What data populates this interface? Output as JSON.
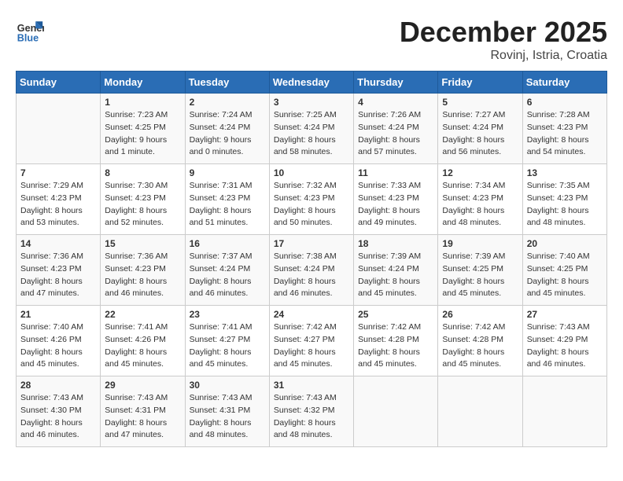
{
  "header": {
    "logo_general": "General",
    "logo_blue": "Blue",
    "month_title": "December 2025",
    "location": "Rovinj, Istria, Croatia"
  },
  "days_of_week": [
    "Sunday",
    "Monday",
    "Tuesday",
    "Wednesday",
    "Thursday",
    "Friday",
    "Saturday"
  ],
  "weeks": [
    [
      {
        "day": "",
        "sunrise": "",
        "sunset": "",
        "daylight": ""
      },
      {
        "day": "1",
        "sunrise": "Sunrise: 7:23 AM",
        "sunset": "Sunset: 4:25 PM",
        "daylight": "Daylight: 9 hours and 1 minute."
      },
      {
        "day": "2",
        "sunrise": "Sunrise: 7:24 AM",
        "sunset": "Sunset: 4:24 PM",
        "daylight": "Daylight: 9 hours and 0 minutes."
      },
      {
        "day": "3",
        "sunrise": "Sunrise: 7:25 AM",
        "sunset": "Sunset: 4:24 PM",
        "daylight": "Daylight: 8 hours and 58 minutes."
      },
      {
        "day": "4",
        "sunrise": "Sunrise: 7:26 AM",
        "sunset": "Sunset: 4:24 PM",
        "daylight": "Daylight: 8 hours and 57 minutes."
      },
      {
        "day": "5",
        "sunrise": "Sunrise: 7:27 AM",
        "sunset": "Sunset: 4:24 PM",
        "daylight": "Daylight: 8 hours and 56 minutes."
      },
      {
        "day": "6",
        "sunrise": "Sunrise: 7:28 AM",
        "sunset": "Sunset: 4:23 PM",
        "daylight": "Daylight: 8 hours and 54 minutes."
      }
    ],
    [
      {
        "day": "7",
        "sunrise": "Sunrise: 7:29 AM",
        "sunset": "Sunset: 4:23 PM",
        "daylight": "Daylight: 8 hours and 53 minutes."
      },
      {
        "day": "8",
        "sunrise": "Sunrise: 7:30 AM",
        "sunset": "Sunset: 4:23 PM",
        "daylight": "Daylight: 8 hours and 52 minutes."
      },
      {
        "day": "9",
        "sunrise": "Sunrise: 7:31 AM",
        "sunset": "Sunset: 4:23 PM",
        "daylight": "Daylight: 8 hours and 51 minutes."
      },
      {
        "day": "10",
        "sunrise": "Sunrise: 7:32 AM",
        "sunset": "Sunset: 4:23 PM",
        "daylight": "Daylight: 8 hours and 50 minutes."
      },
      {
        "day": "11",
        "sunrise": "Sunrise: 7:33 AM",
        "sunset": "Sunset: 4:23 PM",
        "daylight": "Daylight: 8 hours and 49 minutes."
      },
      {
        "day": "12",
        "sunrise": "Sunrise: 7:34 AM",
        "sunset": "Sunset: 4:23 PM",
        "daylight": "Daylight: 8 hours and 48 minutes."
      },
      {
        "day": "13",
        "sunrise": "Sunrise: 7:35 AM",
        "sunset": "Sunset: 4:23 PM",
        "daylight": "Daylight: 8 hours and 48 minutes."
      }
    ],
    [
      {
        "day": "14",
        "sunrise": "Sunrise: 7:36 AM",
        "sunset": "Sunset: 4:23 PM",
        "daylight": "Daylight: 8 hours and 47 minutes."
      },
      {
        "day": "15",
        "sunrise": "Sunrise: 7:36 AM",
        "sunset": "Sunset: 4:23 PM",
        "daylight": "Daylight: 8 hours and 46 minutes."
      },
      {
        "day": "16",
        "sunrise": "Sunrise: 7:37 AM",
        "sunset": "Sunset: 4:24 PM",
        "daylight": "Daylight: 8 hours and 46 minutes."
      },
      {
        "day": "17",
        "sunrise": "Sunrise: 7:38 AM",
        "sunset": "Sunset: 4:24 PM",
        "daylight": "Daylight: 8 hours and 46 minutes."
      },
      {
        "day": "18",
        "sunrise": "Sunrise: 7:39 AM",
        "sunset": "Sunset: 4:24 PM",
        "daylight": "Daylight: 8 hours and 45 minutes."
      },
      {
        "day": "19",
        "sunrise": "Sunrise: 7:39 AM",
        "sunset": "Sunset: 4:25 PM",
        "daylight": "Daylight: 8 hours and 45 minutes."
      },
      {
        "day": "20",
        "sunrise": "Sunrise: 7:40 AM",
        "sunset": "Sunset: 4:25 PM",
        "daylight": "Daylight: 8 hours and 45 minutes."
      }
    ],
    [
      {
        "day": "21",
        "sunrise": "Sunrise: 7:40 AM",
        "sunset": "Sunset: 4:26 PM",
        "daylight": "Daylight: 8 hours and 45 minutes."
      },
      {
        "day": "22",
        "sunrise": "Sunrise: 7:41 AM",
        "sunset": "Sunset: 4:26 PM",
        "daylight": "Daylight: 8 hours and 45 minutes."
      },
      {
        "day": "23",
        "sunrise": "Sunrise: 7:41 AM",
        "sunset": "Sunset: 4:27 PM",
        "daylight": "Daylight: 8 hours and 45 minutes."
      },
      {
        "day": "24",
        "sunrise": "Sunrise: 7:42 AM",
        "sunset": "Sunset: 4:27 PM",
        "daylight": "Daylight: 8 hours and 45 minutes."
      },
      {
        "day": "25",
        "sunrise": "Sunrise: 7:42 AM",
        "sunset": "Sunset: 4:28 PM",
        "daylight": "Daylight: 8 hours and 45 minutes."
      },
      {
        "day": "26",
        "sunrise": "Sunrise: 7:42 AM",
        "sunset": "Sunset: 4:28 PM",
        "daylight": "Daylight: 8 hours and 45 minutes."
      },
      {
        "day": "27",
        "sunrise": "Sunrise: 7:43 AM",
        "sunset": "Sunset: 4:29 PM",
        "daylight": "Daylight: 8 hours and 46 minutes."
      }
    ],
    [
      {
        "day": "28",
        "sunrise": "Sunrise: 7:43 AM",
        "sunset": "Sunset: 4:30 PM",
        "daylight": "Daylight: 8 hours and 46 minutes."
      },
      {
        "day": "29",
        "sunrise": "Sunrise: 7:43 AM",
        "sunset": "Sunset: 4:31 PM",
        "daylight": "Daylight: 8 hours and 47 minutes."
      },
      {
        "day": "30",
        "sunrise": "Sunrise: 7:43 AM",
        "sunset": "Sunset: 4:31 PM",
        "daylight": "Daylight: 8 hours and 48 minutes."
      },
      {
        "day": "31",
        "sunrise": "Sunrise: 7:43 AM",
        "sunset": "Sunset: 4:32 PM",
        "daylight": "Daylight: 8 hours and 48 minutes."
      },
      {
        "day": "",
        "sunrise": "",
        "sunset": "",
        "daylight": ""
      },
      {
        "day": "",
        "sunrise": "",
        "sunset": "",
        "daylight": ""
      },
      {
        "day": "",
        "sunrise": "",
        "sunset": "",
        "daylight": ""
      }
    ]
  ]
}
